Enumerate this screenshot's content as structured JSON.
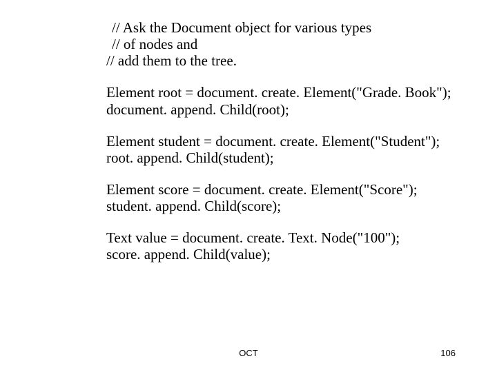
{
  "body": {
    "comment1": "// Ask the Document object for various types",
    "comment2": "// of nodes and",
    "comment3": "//  add them to the tree.",
    "block1_line1": "Element root = document. create. Element(\"Grade. Book\");",
    "block1_line2": "document. append. Child(root);",
    "block2_line1": "Element student = document. create. Element(\"Student\");",
    "block2_line2": "root. append. Child(student);",
    "block3_line1": "Element score = document. create. Element(\"Score\");",
    "block3_line2": "student. append. Child(score);",
    "block4_line1": "Text value = document. create. Text. Node(\"100\");",
    "block4_line2": "score. append. Child(value);"
  },
  "footer": {
    "center": "OCT",
    "page": "106"
  }
}
